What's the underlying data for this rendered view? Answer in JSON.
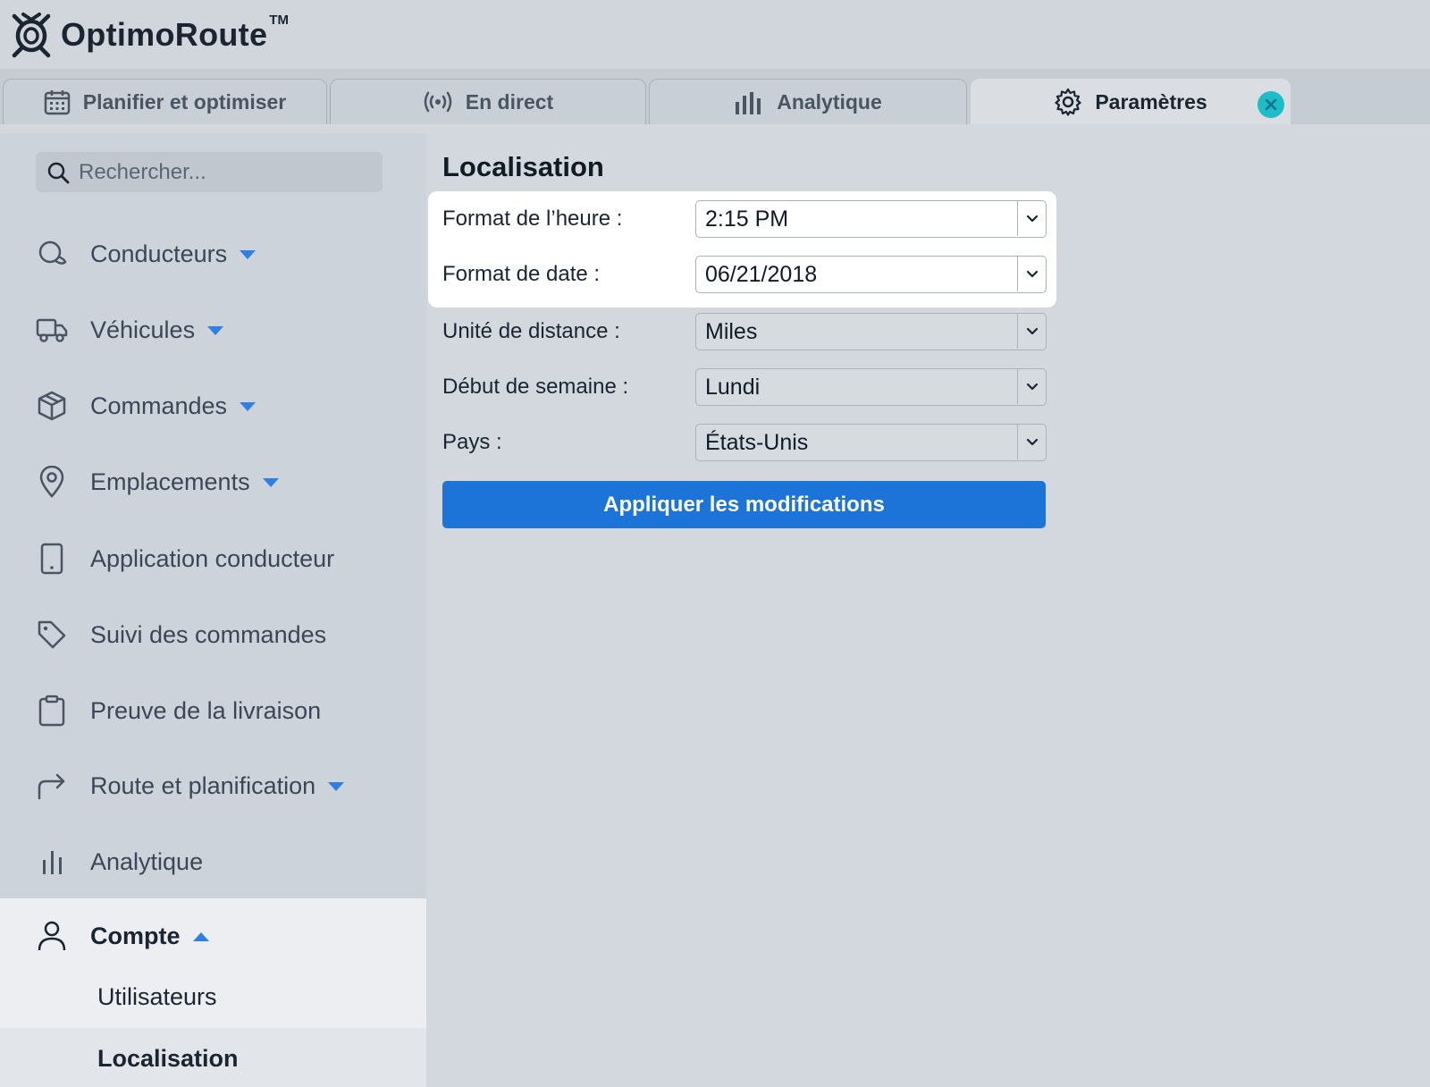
{
  "app": {
    "brand": "OptimoRoute",
    "trademark": "TM",
    "accent_color": "#1c74d9",
    "close_color": "#1bbdc9"
  },
  "tabs": [
    {
      "label": "Planifier et optimiser",
      "icon": "calendar-icon",
      "active": false
    },
    {
      "label": "En direct",
      "icon": "broadcast-icon",
      "active": false
    },
    {
      "label": "Analytique",
      "icon": "bar-chart-icon",
      "active": false
    },
    {
      "label": "Paramètres",
      "icon": "gear-icon",
      "active": true
    }
  ],
  "sidebar": {
    "search_placeholder": "Rechercher...",
    "items": [
      {
        "label": "Conducteurs",
        "icon": "driver-icon",
        "expandable": true
      },
      {
        "label": "Véhicules",
        "icon": "truck-icon",
        "expandable": true
      },
      {
        "label": "Commandes",
        "icon": "package-icon",
        "expandable": true
      },
      {
        "label": "Emplacements",
        "icon": "location-pin-icon",
        "expandable": true
      },
      {
        "label": "Application conducteur",
        "icon": "phone-icon",
        "expandable": false
      },
      {
        "label": "Suivi des commandes",
        "icon": "tag-icon",
        "expandable": false
      },
      {
        "label": "Preuve de la livraison",
        "icon": "clipboard-icon",
        "expandable": false
      },
      {
        "label": "Route et planification",
        "icon": "route-arrow-icon",
        "expandable": true
      },
      {
        "label": "Analytique",
        "icon": "bar-chart-icon",
        "expandable": false
      },
      {
        "label": "Compte",
        "icon": "user-icon",
        "expandable": true,
        "expanded": true
      }
    ],
    "subitems": [
      {
        "label": "Utilisateurs",
        "active": false
      },
      {
        "label": "Localisation",
        "active": true
      }
    ]
  },
  "main": {
    "title": "Localisation",
    "fields": [
      {
        "label": "Format de l’heure :",
        "value": "2:15 PM"
      },
      {
        "label": "Format de date :",
        "value": "06/21/2018"
      },
      {
        "label": "Unité de distance :",
        "value": "Miles"
      },
      {
        "label": "Début de semaine :",
        "value": "Lundi"
      },
      {
        "label": "Pays :",
        "value": "États-Unis"
      }
    ],
    "apply_label": "Appliquer les modifications"
  }
}
